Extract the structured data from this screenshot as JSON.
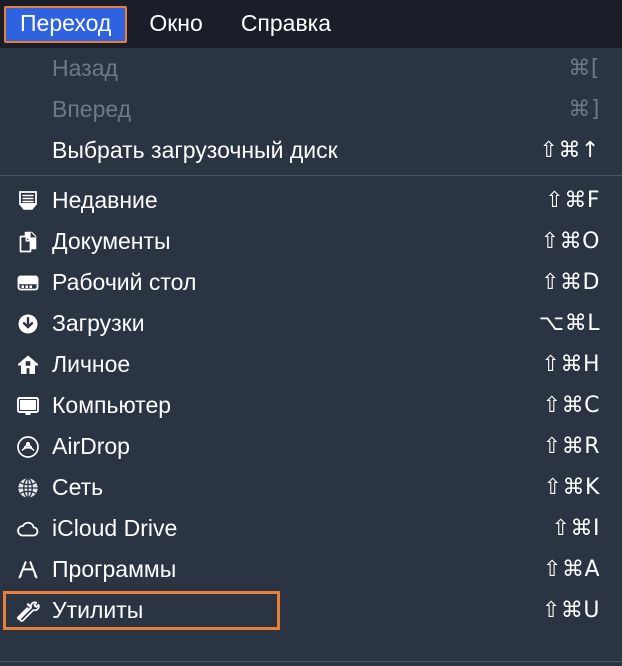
{
  "menubar": {
    "items": [
      {
        "label": "Переход",
        "active": true
      },
      {
        "label": "Окно",
        "active": false
      },
      {
        "label": "Справка",
        "active": false
      }
    ]
  },
  "colors": {
    "menubar_background": "#1b1e28",
    "menu_background": "#2b3442",
    "highlight_blue": "#2f62df",
    "selection_orange": "#e8803a",
    "text": "#ffffff",
    "text_disabled": "#6d7889",
    "separator": "#4b5568"
  },
  "menu": {
    "groups": [
      {
        "items": [
          {
            "label": "Назад",
            "shortcut": "⌘[",
            "icon": "none",
            "disabled": true,
            "selected": false
          },
          {
            "label": "Вперед",
            "shortcut": "⌘]",
            "icon": "none",
            "disabled": true,
            "selected": false
          },
          {
            "label": "Выбрать загрузочный диск",
            "shortcut": "⇧⌘↑",
            "icon": "none",
            "disabled": false,
            "selected": false
          }
        ]
      },
      {
        "items": [
          {
            "label": "Недавние",
            "shortcut": "⇧⌘F",
            "icon": "recents-icon",
            "disabled": false,
            "selected": false
          },
          {
            "label": "Документы",
            "shortcut": "⇧⌘O",
            "icon": "documents-icon",
            "disabled": false,
            "selected": false
          },
          {
            "label": "Рабочий стол",
            "shortcut": "⇧⌘D",
            "icon": "desktop-icon",
            "disabled": false,
            "selected": false
          },
          {
            "label": "Загрузки",
            "shortcut": "⌥⌘L",
            "icon": "downloads-icon",
            "disabled": false,
            "selected": false
          },
          {
            "label": "Личное",
            "shortcut": "⇧⌘H",
            "icon": "home-icon",
            "disabled": false,
            "selected": false
          },
          {
            "label": "Компьютер",
            "shortcut": "⇧⌘C",
            "icon": "computer-icon",
            "disabled": false,
            "selected": false
          },
          {
            "label": "AirDrop",
            "shortcut": "⇧⌘R",
            "icon": "airdrop-icon",
            "disabled": false,
            "selected": false
          },
          {
            "label": "Сеть",
            "shortcut": "⇧⌘K",
            "icon": "network-icon",
            "disabled": false,
            "selected": false
          },
          {
            "label": "iCloud Drive",
            "shortcut": "⇧⌘I",
            "icon": "icloud-icon",
            "disabled": false,
            "selected": false
          },
          {
            "label": "Программы",
            "shortcut": "⇧⌘A",
            "icon": "applications-icon",
            "disabled": false,
            "selected": false
          },
          {
            "label": "Утилиты",
            "shortcut": "⇧⌘U",
            "icon": "utilities-icon",
            "disabled": false,
            "selected": true
          }
        ]
      }
    ]
  }
}
